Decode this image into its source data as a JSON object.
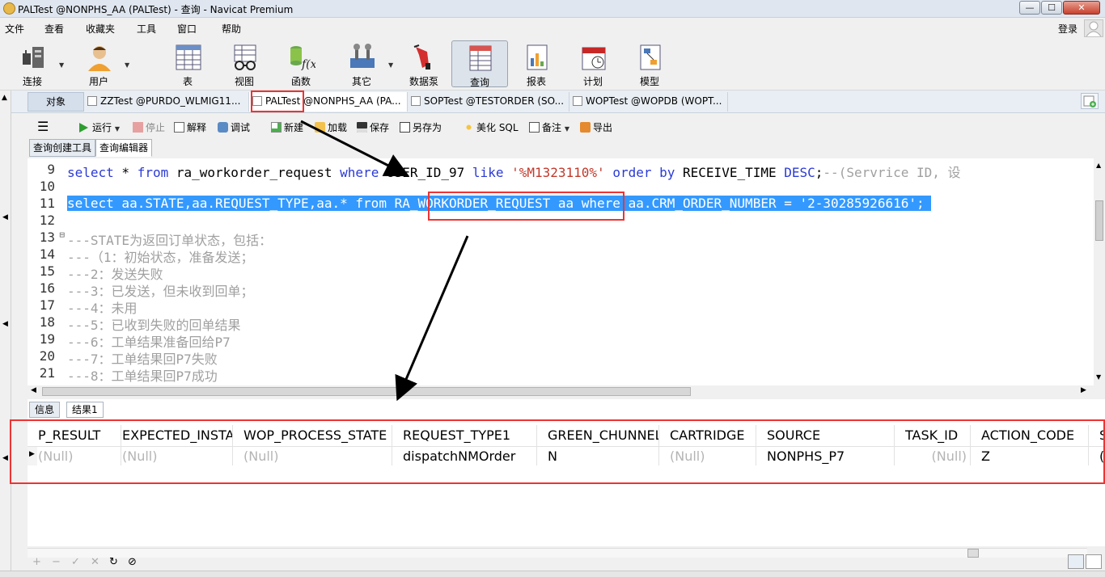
{
  "window": {
    "title": "PALTest @NONPHS_AA (PALTest) - 查询 - Navicat Premium",
    "min": "—",
    "max": "☐",
    "close": "✕"
  },
  "menu": [
    "文件",
    "查看",
    "收藏夹",
    "工具",
    "窗口",
    "帮助"
  ],
  "login": "登录",
  "toolbar": [
    "连接",
    "用户",
    "表",
    "视图",
    "函数",
    "其它",
    "数据泵",
    "查询",
    "报表",
    "计划",
    "模型"
  ],
  "tabs": {
    "objects": "对象",
    "files": [
      "ZZTest @PURDO_WLMIG11...",
      "PALTest @NONPHS_AA (PA...",
      "SOPTest @TESTORDER (SO...",
      "WOPTest @WOPDB (WOPT..."
    ]
  },
  "query_toolbar": {
    "run": "运行",
    "stop": "停止",
    "explain": "解释",
    "debug": "调试",
    "new": "新建",
    "load": "加载",
    "save": "保存",
    "save_as": "另存为",
    "beautify": "美化 SQL",
    "note": "备注",
    "export": "导出"
  },
  "subtabs": [
    "查询创建工具",
    "查询编辑器"
  ],
  "editor": {
    "lines": [
      {
        "n": "9",
        "text": "select * from ra_workorder_request where USER_ID_97 like '%M1323110%' order by RECEIVE_TIME DESC;--(Servrice ID, 设"
      },
      {
        "n": "10",
        "text": ""
      },
      {
        "n": "11",
        "text": "select aa.STATE,aa.REQUEST_TYPE,aa.* from RA_WORKORDER_REQUEST aa where aa.CRM_ORDER_NUMBER = '2-30285926616';"
      },
      {
        "n": "12",
        "text": ""
      },
      {
        "n": "13",
        "text": "---STATE为返回订单状态，包括："
      },
      {
        "n": "14",
        "text": "---（1：初始状态，准备发送；"
      },
      {
        "n": "15",
        "text": "---2：发送失败"
      },
      {
        "n": "16",
        "text": "---3：已发送，但未收到回单；"
      },
      {
        "n": "17",
        "text": "---4：未用"
      },
      {
        "n": "18",
        "text": "---5：已收到失败的回单结果"
      },
      {
        "n": "19",
        "text": "---6：工单结果准备回给P7"
      },
      {
        "n": "20",
        "text": "---7：工单结果回P7失败"
      },
      {
        "n": "21",
        "text": "---8：工单结果回P7成功"
      }
    ],
    "fold_marker": "⊟"
  },
  "result_tabs": [
    "信息",
    "结果1"
  ],
  "grid": {
    "headers": [
      "P_RESULT",
      "EXPECTED_INSTALL",
      "WOP_PROCESS_STATE",
      "REQUEST_TYPE1",
      "GREEN_CHUNNEL_",
      "CARTRIDGE",
      "SOURCE",
      "TASK_ID",
      "ACTION_CODE",
      "S"
    ],
    "row": [
      "(Null)",
      "(Null)",
      "(Null)",
      "dispatchNMOrder",
      "N",
      "(Null)",
      "NONPHS_P7",
      "(Null)",
      "Z",
      "("
    ]
  },
  "grid_footer": [
    "+",
    "−",
    "✓",
    "✕",
    "↻",
    "⊘"
  ],
  "colors": {
    "selection": "#3399ff",
    "keyword": "#2b3ad6",
    "string": "#c0392b",
    "comment": "#a0a0a0",
    "annotation": "#ee3333"
  }
}
